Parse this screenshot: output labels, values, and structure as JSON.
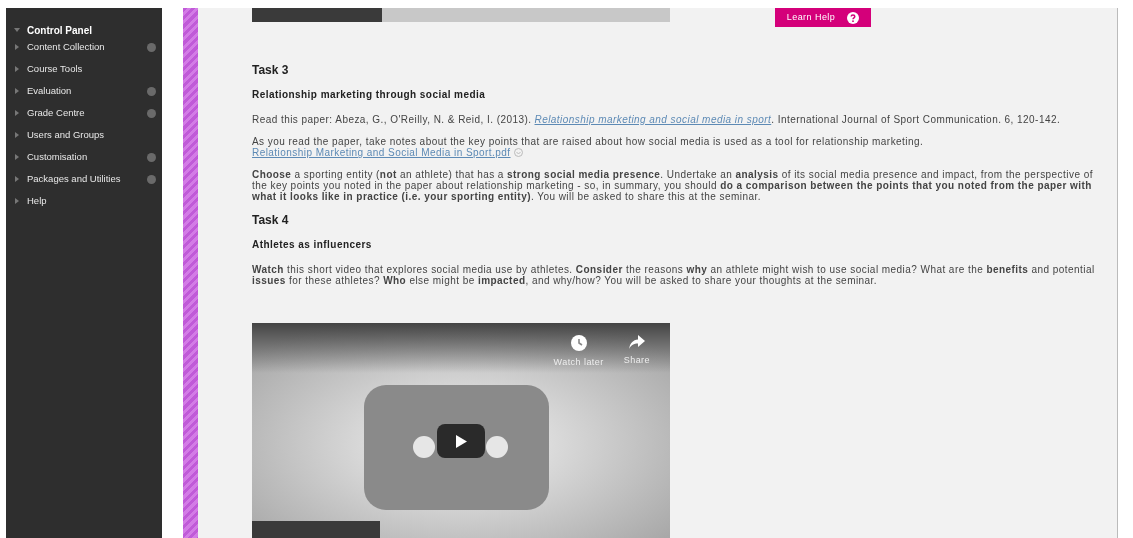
{
  "sidebar": {
    "title": "Control Panel",
    "expanded": true,
    "items": [
      {
        "label": "Content Collection",
        "options": true
      },
      {
        "label": "Course Tools",
        "options": false
      },
      {
        "label": "Evaluation",
        "options": true
      },
      {
        "label": "Grade Centre",
        "options": true
      },
      {
        "label": "Users and Groups",
        "options": false
      },
      {
        "label": "Customisation",
        "options": true
      },
      {
        "label": "Packages and Utilities",
        "options": true
      },
      {
        "label": "Help",
        "options": false
      }
    ]
  },
  "help_button": {
    "label": "Learn Help"
  },
  "previous_video": {
    "level": 0.31
  },
  "tasks": [
    {
      "title": "Task 3",
      "subtitle": "Relationship marketing through social media",
      "blocks": [
        {
          "kind": "citation",
          "before": "Read this paper: Abeza, G., O'Reilly, N. & Reid, I. (2013).",
          "link": "Relationship marketing and social media in sport",
          "after": ". International Journal of Sport Communication. 6, 120-142."
        },
        {
          "kind": "text",
          "text": "As you read the paper, take notes about the key points that are raised about how social media is used as a tool for relationship marketing."
        },
        {
          "kind": "file",
          "link": "Relationship Marketing and Social Media in Sport.pdf"
        },
        {
          "kind": "text",
          "text": "**Choose** a sporting entity (**not** an athlete) that has a **strong social media presence**. Undertake an **analysis** of its social media presence and impact, from the perspective of the key points you noted in the paper about relationship marketing - so, in summary, you should **do a comparison between the points that you noted from the paper with what it looks like in practice (i.e. your sporting entity)**. You will be asked to share this at the seminar."
        }
      ]
    },
    {
      "title": "Task 4",
      "subtitle": "Athletes as influencers",
      "blocks": [
        {
          "kind": "text",
          "text": "**Watch** this short video that explores social media use by athletes. **Consider** the reasons **why** an athlete might wish to use social media? What are the **benefits** and potential **issues** for these athletes? **Who** else might be **impacted**, and why/how? You will be asked to share your thoughts at the seminar."
        }
      ]
    }
  ],
  "video": {
    "actions": [
      {
        "kind": "clock",
        "label": "Watch later"
      },
      {
        "kind": "share",
        "label": "Share"
      }
    ]
  }
}
